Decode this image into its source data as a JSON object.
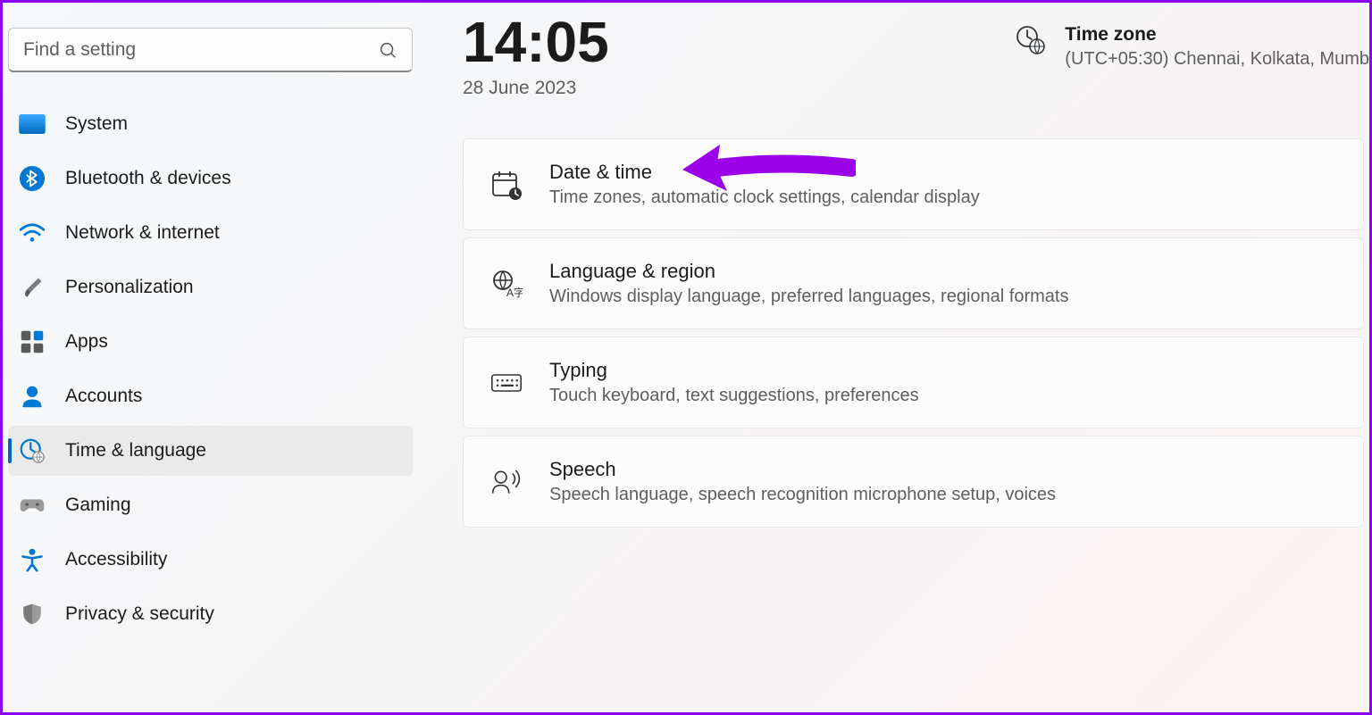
{
  "sidebar": {
    "search_placeholder": "Find a setting",
    "items": [
      {
        "id": "system",
        "label": "System"
      },
      {
        "id": "bluetooth",
        "label": "Bluetooth & devices"
      },
      {
        "id": "network",
        "label": "Network & internet"
      },
      {
        "id": "personalization",
        "label": "Personalization"
      },
      {
        "id": "apps",
        "label": "Apps"
      },
      {
        "id": "accounts",
        "label": "Accounts"
      },
      {
        "id": "time-language",
        "label": "Time & language"
      },
      {
        "id": "gaming",
        "label": "Gaming"
      },
      {
        "id": "accessibility",
        "label": "Accessibility"
      },
      {
        "id": "privacy-security",
        "label": "Privacy & security"
      }
    ],
    "selected_index": 6
  },
  "header": {
    "time": "14:05",
    "date": "28 June 2023",
    "timezone_label": "Time zone",
    "timezone_value": "(UTC+05:30) Chennai, Kolkata, Mumb"
  },
  "cards": [
    {
      "id": "date-time",
      "title": "Date & time",
      "desc": "Time zones, automatic clock settings, calendar display"
    },
    {
      "id": "language-region",
      "title": "Language & region",
      "desc": "Windows display language, preferred languages, regional formats"
    },
    {
      "id": "typing",
      "title": "Typing",
      "desc": "Touch keyboard, text suggestions, preferences"
    },
    {
      "id": "speech",
      "title": "Speech",
      "desc": "Speech language, speech recognition microphone setup, voices"
    }
  ]
}
